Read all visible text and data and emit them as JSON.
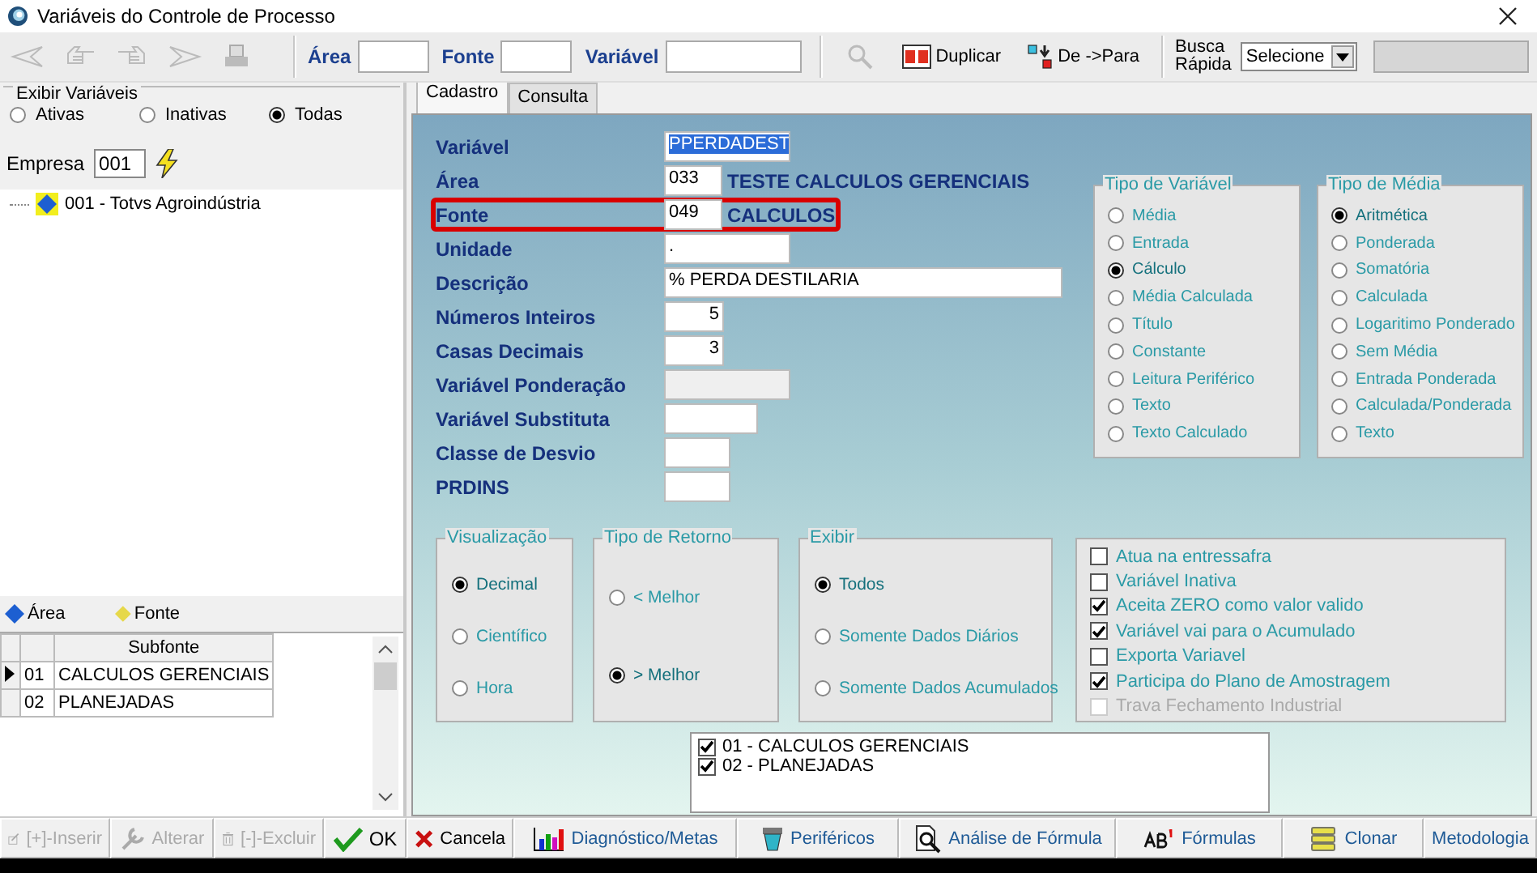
{
  "window": {
    "title": "Variáveis do Controle de Processo"
  },
  "toolbar": {
    "filters": [
      {
        "label": "Área",
        "kind": "short"
      },
      {
        "label": "Fonte",
        "kind": "short"
      },
      {
        "label": "Variável",
        "kind": "long"
      }
    ],
    "actions": [
      {
        "label": "Duplicar",
        "kind": "duplicate"
      },
      {
        "label": "De ->Para",
        "kind": "mapping"
      }
    ],
    "quick_search": {
      "label_lines": [
        "Busca",
        "Rápida"
      ],
      "value": "Selecione"
    }
  },
  "show_variables": {
    "title": "Exibir Variáveis",
    "options": [
      {
        "label": "Ativas",
        "selected": false
      },
      {
        "label": "Inativas",
        "selected": false
      },
      {
        "label": "Todas",
        "selected": true
      }
    ]
  },
  "company": {
    "label": "Empresa",
    "value": "001"
  },
  "tree": [
    {
      "label": "001 - Totvs Agroindústria"
    }
  ],
  "legend": [
    {
      "label": "Área",
      "color": "#1d5fd1"
    },
    {
      "label": "Fonte",
      "color": "#e6d84a"
    }
  ],
  "subfonte_grid": {
    "columns": [
      "Subfonte"
    ],
    "rows": [
      {
        "code": "01",
        "name": "CALCULOS GERENCIAIS",
        "selected": true
      },
      {
        "code": "02",
        "name": "PLANEJADAS",
        "selected": false
      }
    ]
  },
  "tabs": [
    {
      "label": "Cadastro",
      "selected": true
    },
    {
      "label": "Consulta",
      "selected": false
    }
  ],
  "form": [
    {
      "label": "Variável",
      "value": "PPERDADEST",
      "kind": "text",
      "selected": true,
      "highlighted": false,
      "disabled": false
    },
    {
      "label": "Área",
      "value": "033",
      "description": "TESTE CALCULOS GERENCIAIS",
      "kind": "code",
      "selected": false,
      "highlighted": false,
      "disabled": false
    },
    {
      "label": "Fonte",
      "value": "049",
      "description": "CALCULOS",
      "kind": "code",
      "selected": false,
      "highlighted": true,
      "disabled": false
    },
    {
      "label": "Unidade",
      "value": ".",
      "kind": "text",
      "selected": false,
      "highlighted": false,
      "disabled": false
    },
    {
      "label": "Descrição",
      "value": "% PERDA DESTILARIA",
      "kind": "long",
      "selected": false,
      "highlighted": false,
      "disabled": false
    },
    {
      "label": "Números Inteiros",
      "value": "5",
      "kind": "number",
      "selected": false,
      "highlighted": false,
      "disabled": false
    },
    {
      "label": "Casas Decimais",
      "value": "3",
      "kind": "number",
      "selected": false,
      "highlighted": false,
      "disabled": false
    },
    {
      "label": "Variável  Ponderação",
      "kind": "text",
      "highlighted": false,
      "disabled": true
    },
    {
      "label": "Variável  Substituta",
      "kind": "small",
      "highlighted": false,
      "disabled": false
    },
    {
      "label": "Classe de Desvio",
      "kind": "tiny",
      "highlighted": false,
      "disabled": false
    },
    {
      "label": "PRDINS",
      "kind": "tiny",
      "highlighted": false,
      "disabled": false
    }
  ],
  "tipo_variavel": {
    "title": "Tipo de Variável",
    "options": [
      {
        "label": "Média",
        "selected": false
      },
      {
        "label": "Entrada",
        "selected": false
      },
      {
        "label": "Cálculo",
        "selected": true
      },
      {
        "label": "Média Calculada",
        "selected": false
      },
      {
        "label": "Título",
        "selected": false
      },
      {
        "label": "Constante",
        "selected": false
      },
      {
        "label": "Leitura Periférico",
        "selected": false
      },
      {
        "label": "Texto",
        "selected": false
      },
      {
        "label": "Texto Calculado",
        "selected": false
      }
    ]
  },
  "tipo_media": {
    "title": "Tipo de Média",
    "options": [
      {
        "label": "Aritmética",
        "selected": true
      },
      {
        "label": "Ponderada",
        "selected": false
      },
      {
        "label": "Somatória",
        "selected": false
      },
      {
        "label": "Calculada",
        "selected": false
      },
      {
        "label": "Logaritimo Ponderado",
        "selected": false
      },
      {
        "label": "Sem Média",
        "selected": false
      },
      {
        "label": "Entrada Ponderada",
        "selected": false
      },
      {
        "label": "Calculada/Ponderada",
        "selected": false
      },
      {
        "label": "Texto",
        "selected": false
      }
    ]
  },
  "visualizacao": {
    "title": "Visualização",
    "options": [
      {
        "label": "Decimal",
        "selected": true
      },
      {
        "label": "Científico",
        "selected": false
      },
      {
        "label": "Hora",
        "selected": false
      }
    ]
  },
  "tipo_retorno": {
    "title": "Tipo de Retorno",
    "options": [
      {
        "label": "< Melhor",
        "selected": false
      },
      {
        "label": "> Melhor",
        "selected": true
      }
    ]
  },
  "exibir": {
    "title": "Exibir",
    "options": [
      {
        "label": "Todos",
        "selected": true
      },
      {
        "label": "Somente Dados Diários",
        "selected": false
      },
      {
        "label": "Somente Dados Acumulados",
        "selected": false
      }
    ]
  },
  "flags": [
    {
      "label": "Atua na entressafra",
      "checked": false,
      "disabled": false
    },
    {
      "label": "Variável Inativa",
      "checked": false,
      "disabled": false
    },
    {
      "label": "Aceita ZERO como valor valido",
      "checked": true,
      "disabled": false
    },
    {
      "label": "Variável vai para o Acumulado",
      "checked": true,
      "disabled": false
    },
    {
      "label": "Exporta Variavel",
      "checked": false,
      "disabled": false
    },
    {
      "label": "Participa do Plano de Amostragem",
      "checked": true,
      "disabled": false
    },
    {
      "label": "Trava Fechamento Industrial",
      "checked": false,
      "disabled": true
    }
  ],
  "subfonte_list": [
    {
      "label": "01 - CALCULOS GERENCIAIS",
      "checked": true
    },
    {
      "label": "02 - PLANEJADAS",
      "checked": true
    }
  ],
  "left_buttons": [
    {
      "label": "[+]-Inserir",
      "kind": "insert",
      "disabled": true
    },
    {
      "label": "Alterar",
      "kind": "edit",
      "disabled": true
    },
    {
      "label": "[-]-Excluir",
      "kind": "delete",
      "disabled": true
    },
    {
      "label": "OK",
      "kind": "ok",
      "disabled": false
    }
  ],
  "buttons": [
    {
      "label": "Cancela",
      "kind": "cancel"
    },
    {
      "label": "Diagnóstico/Metas",
      "kind": "chart"
    },
    {
      "label": "Periféricos",
      "kind": "device"
    },
    {
      "label": "Análise de Fórmula",
      "kind": "analysis"
    },
    {
      "label": "Fórmulas",
      "kind": "formula"
    },
    {
      "label": "Clonar",
      "kind": "clone"
    },
    {
      "label": "Metodologia",
      "kind": "plain"
    }
  ]
}
